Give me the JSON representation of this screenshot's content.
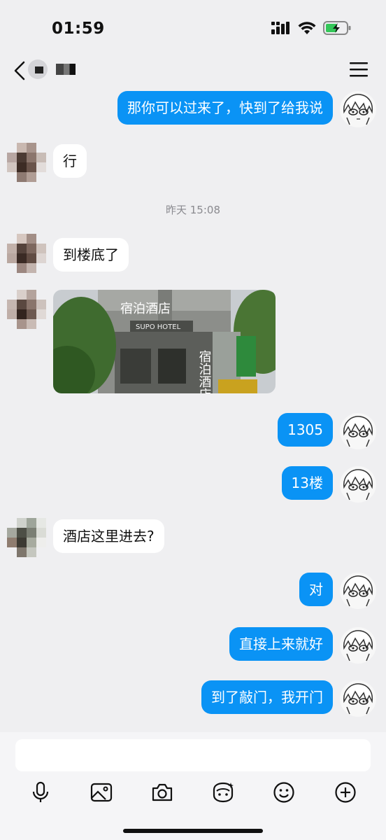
{
  "status_bar": {
    "time": "01:59"
  },
  "header": {
    "title": ""
  },
  "messages": [
    {
      "side": "out",
      "text": "那你可以过来了，快到了给我说"
    },
    {
      "side": "in",
      "text": "行"
    },
    {
      "type": "time",
      "text": "昨天 15:08"
    },
    {
      "side": "in",
      "text": "到楼底了"
    },
    {
      "side": "in",
      "type": "image",
      "sign_top": "宿泊酒店",
      "sign_en": "SUPO HOTEL",
      "sign_vertical": "宿泊酒店"
    },
    {
      "side": "out",
      "text": "1305"
    },
    {
      "side": "out",
      "text": "13楼"
    },
    {
      "side": "in",
      "text": "酒店这里进去?"
    },
    {
      "side": "out",
      "text": "对"
    },
    {
      "side": "out",
      "text": "直接上来就好"
    },
    {
      "side": "out",
      "text": "到了敲门，我开门"
    }
  ],
  "input": {
    "placeholder": ""
  },
  "toolbar": [
    "mic-icon",
    "image-icon",
    "camera-icon",
    "ai-face-icon",
    "emoji-icon",
    "plus-icon"
  ],
  "colors": {
    "outgoing_bubble": "#0a93f5",
    "background": "#efeff1",
    "incoming_bubble": "#ffffff"
  }
}
